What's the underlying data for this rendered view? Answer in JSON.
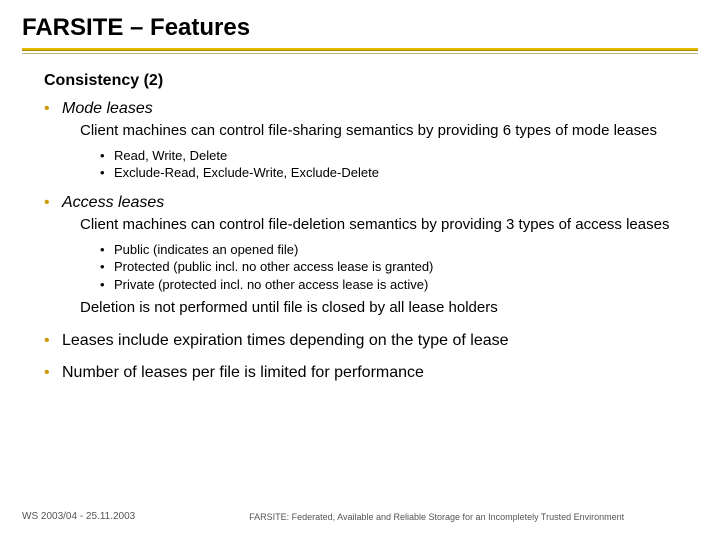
{
  "title": "FARSITE – Features",
  "subtitle": "Consistency (2)",
  "sections": [
    {
      "heading": "Mode leases",
      "paragraphs": [
        "Client machines can control file-sharing semantics by providing 6 types of mode leases"
      ],
      "sub": [
        "Read, Write, Delete",
        "Exclude-Read, Exclude-Write, Exclude-Delete"
      ]
    },
    {
      "heading": "Access leases",
      "paragraphs": [
        "Client machines can control file-deletion semantics by providing 3 types of access leases"
      ],
      "sub": [
        "Public (indicates an opened file)",
        "Protected (public incl. no other access lease is granted)",
        "Private (protected incl. no other access lease is active)"
      ],
      "paragraphs_after": [
        "Deletion is not performed until file is closed by all lease holders"
      ]
    }
  ],
  "plain_bullets": [
    "Leases include expiration times depending on the type of lease",
    "Number of leases per file is limited for performance"
  ],
  "footer": {
    "left": "WS 2003/04 - 25.11.2003",
    "right": "FARSITE: Federated, Available and Reliable Storage for an Incompletely Trusted Environment"
  }
}
